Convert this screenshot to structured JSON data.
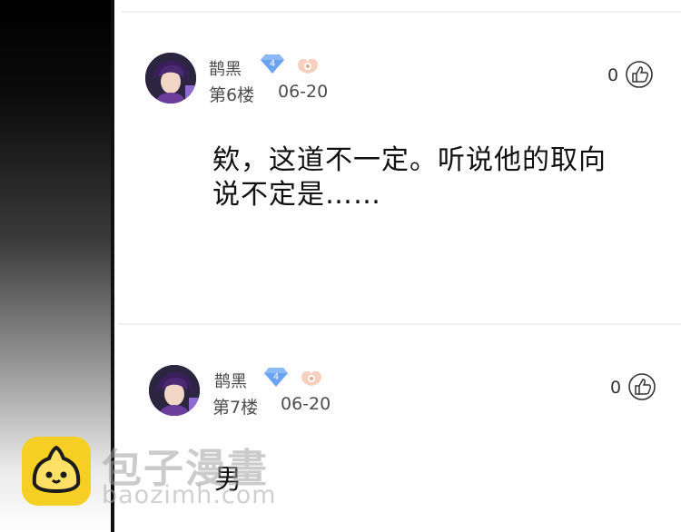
{
  "comments": [
    {
      "user": "鹊黑",
      "level": "4",
      "floor": "第6楼",
      "date": "06-20",
      "likes": "0",
      "text_lines": [
        "欸，这道不一定。听说他的取向",
        "说不定是……"
      ]
    },
    {
      "user": "鹊黑",
      "level": "4",
      "floor": "第7楼",
      "date": "06-20",
      "likes": "0",
      "text_lines": [
        "男"
      ]
    }
  ],
  "watermark": {
    "title": "包子漫畫",
    "url": "baozimh.com"
  },
  "colors": {
    "badge_blue": "#6aa3f2",
    "badge_peach": "#f3c8b4",
    "logo_yellow": "#f7cf24"
  }
}
